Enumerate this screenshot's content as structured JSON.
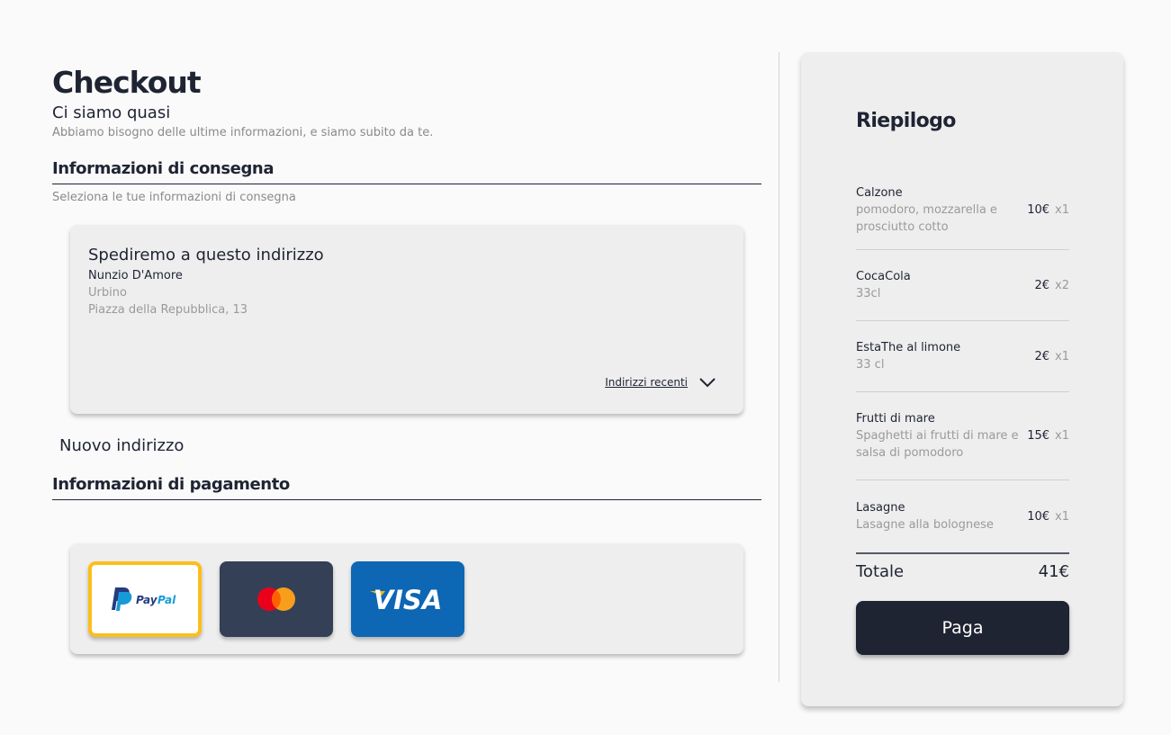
{
  "checkout": {
    "title": "Checkout",
    "subtitle": "Ci siamo quasi",
    "description": "Abbiamo bisogno delle ultime informazioni, e siamo subito da te."
  },
  "delivery": {
    "section_title": "Informazioni di consegna",
    "hint": "Seleziona le tue informazioni di consegna",
    "card_heading": "Spediremo a questo indirizzo",
    "name": "Nunzio D'Amore",
    "city": "Urbino",
    "street": "Piazza della Repubblica, 13",
    "recent_label": "Indirizzi recenti",
    "recent_icon": "chevron-down-icon",
    "new_address": "Nuovo indirizzo"
  },
  "payment": {
    "section_title": "Informazioni di pagamento",
    "methods": [
      {
        "name": "PayPal",
        "logo_text_1": "Pay",
        "logo_text_2": "Pal",
        "selected": true,
        "border_color": "#fcbf1a"
      },
      {
        "name": "Mastercard",
        "selected": false
      },
      {
        "name": "Visa",
        "logo_text": "VISA",
        "selected": false
      }
    ]
  },
  "summary": {
    "title": "Riepilogo",
    "items": [
      {
        "name": "Calzone",
        "desc": "pomodoro, mozzarella e prosciutto cotto",
        "price": "10€",
        "qty": "x1"
      },
      {
        "name": "CocaCola",
        "desc": "33cl",
        "price": "2€",
        "qty": "x2"
      },
      {
        "name": "EstaThe al limone",
        "desc": "33 cl",
        "price": "2€",
        "qty": "x1"
      },
      {
        "name": "Frutti di mare",
        "desc": "Spaghetti ai frutti di mare e salsa di pomodoro",
        "price": "15€",
        "qty": "x1"
      },
      {
        "name": "Lasagne",
        "desc": "Lasagne alla bolognese",
        "price": "10€",
        "qty": "x1"
      }
    ],
    "total_label": "Totale",
    "total_value": "41€",
    "pay_label": "Paga"
  },
  "colors": {
    "primary_dark": "#1f2433",
    "paypal_border": "#fcbf1a",
    "mastercard_bg": "#344056",
    "visa_bg": "#0d67b4"
  }
}
